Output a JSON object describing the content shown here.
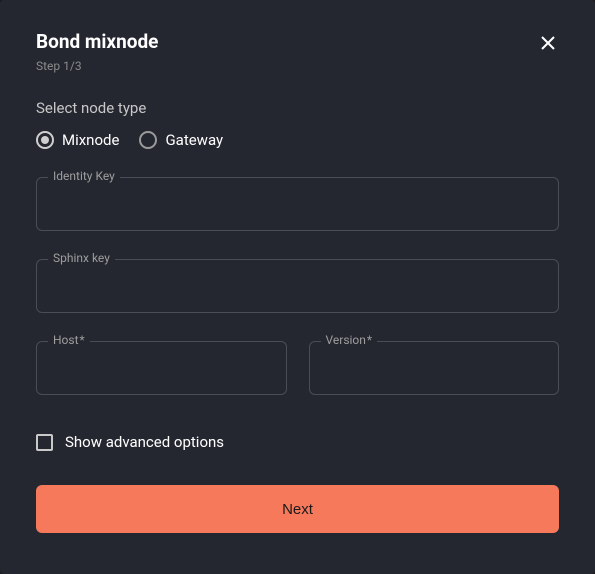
{
  "header": {
    "title": "Bond mixnode",
    "step": "Step 1/3"
  },
  "section": {
    "label": "Select node type",
    "options": {
      "mixnode": "Mixnode",
      "gateway": "Gateway"
    }
  },
  "fields": {
    "identity_key": {
      "label": "Identity Key",
      "value": ""
    },
    "sphinx_key": {
      "label": "Sphinx key",
      "value": ""
    },
    "host": {
      "label": "Host",
      "required_mark": "*",
      "value": ""
    },
    "version": {
      "label": "Version",
      "required_mark": "*",
      "value": ""
    }
  },
  "advanced": {
    "label": "Show advanced options",
    "checked": false
  },
  "actions": {
    "next": "Next"
  }
}
